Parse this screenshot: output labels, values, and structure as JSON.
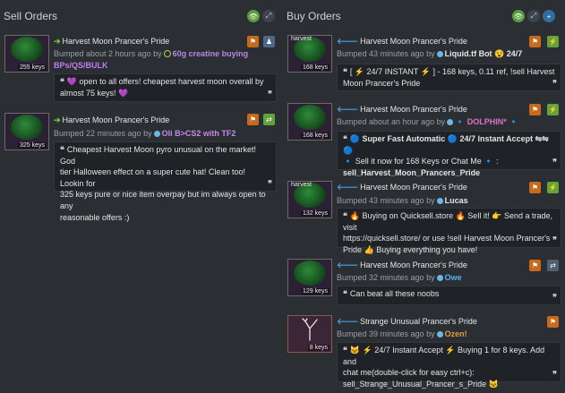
{
  "sell_orders": {
    "title": "Sell Orders",
    "listings": [
      {
        "item_name": "Harvest Moon Prancer's Pride",
        "keys": "255 keys",
        "bumped_text": "Bumped about 2 hours ago by",
        "user": "60g creatine buying BPs/QS/BULK",
        "user_line2": "BPs/QS/BULK",
        "user_line1": "60g creatine buying",
        "message": "💜 open to all offers! cheapest harvest moon overall by almost 75 keys! 💜",
        "message_line1": "💜 open to all offers! cheapest harvest moon overall by",
        "message_line2": "almost 75 keys! 💜"
      },
      {
        "item_name": "Harvest Moon Prancer's Pride",
        "keys": "325 keys",
        "bumped_text": "Bumped 22 minutes ago by",
        "user": "Oli B>CS2 with TF2",
        "message_line1": "Cheapest Harvest Moon pyro unusual on the market! God",
        "message_line2": "tier Halloween effect on a super cute hat! Clean too! Lookin for",
        "message_line3": "325 keys pure or nice item overpay but im always open to any",
        "message_line4": "reasonable offers :)"
      }
    ]
  },
  "buy_orders": {
    "title": "Buy Orders",
    "listings": [
      {
        "item_name": "Harvest Moon Prancer's Pride",
        "thumb_label": "harvest",
        "keys": "168 keys",
        "bumped_text": "Bumped 43 minutes ago by",
        "user": "Liquid.tf Bot 😵 24/7",
        "message_line1": "[ ⚡ 24/7 INSTANT ⚡ ] - 168 keys, 0.11 ref, !sell Harvest",
        "message_line2": "Moon Prancer's Pride"
      },
      {
        "item_name": "Harvest Moon Prancer's Pride",
        "keys": "168 keys",
        "bumped_text": "Bumped about an hour ago by",
        "user": "🔹 DOLPHIN* 🔹",
        "message_line1": "🔵 Super Fast Automatic 🔵 24/7 Instant Accept ⇋⇋ 🔵",
        "message_line2": "🔹 Sell it now for 168 Keys or Chat Me 🔹 :",
        "message_line3": "sell_Harvest_Moon_Prancers_Pride"
      },
      {
        "item_name": "Harvest Moon Prancer's Pride",
        "thumb_label": "harvest",
        "keys": "132 keys",
        "bumped_text": "Bumped 43 minutes ago by",
        "user": "Lucas",
        "message_line1": "🔥 Buying on Quicksell.store 🔥 Sell it! 👉 Send a trade, visit",
        "message_line2": "https://quicksell.store/ or use !sell Harvest Moon Prancer's",
        "message_line3": "Pride 👍 Buying everything you have!"
      },
      {
        "item_name": "Harvest Moon Prancer's Pride",
        "keys": "129 keys",
        "bumped_text": "Bumped 32 minutes ago by",
        "user": "Owe",
        "message_line1": "Can beat all these noobs"
      },
      {
        "item_name": "Strange Unusual Prancer's Pride",
        "keys": "8 keys",
        "bumped_text": "Bumped 39 minutes ago by",
        "user": "Ozen!",
        "message_line1": "🐱 ⚡ 24/7 Instant Accept ⚡ Buying 1 for 8 keys. Add and",
        "message_line2": "chat me(double-click for easy ctrl+c):",
        "message_line3": "sell_Strange_Unusual_Prancer_s_Pride 🐱"
      }
    ]
  },
  "icons": {
    "eye": "eye-icon",
    "expand": "expand-icon",
    "plus": "plus-icon",
    "trade": "trade-icon",
    "lightning": "lightning-icon",
    "quote": "quote-icon",
    "flag": "flag-icon"
  },
  "colors": {
    "background": "#2b2e33",
    "accent_green": "#5b9a3c",
    "flag_orange": "#c86a1c",
    "sell_arrow": "#7ac240",
    "buy_arrow": "#4f9ed8"
  }
}
